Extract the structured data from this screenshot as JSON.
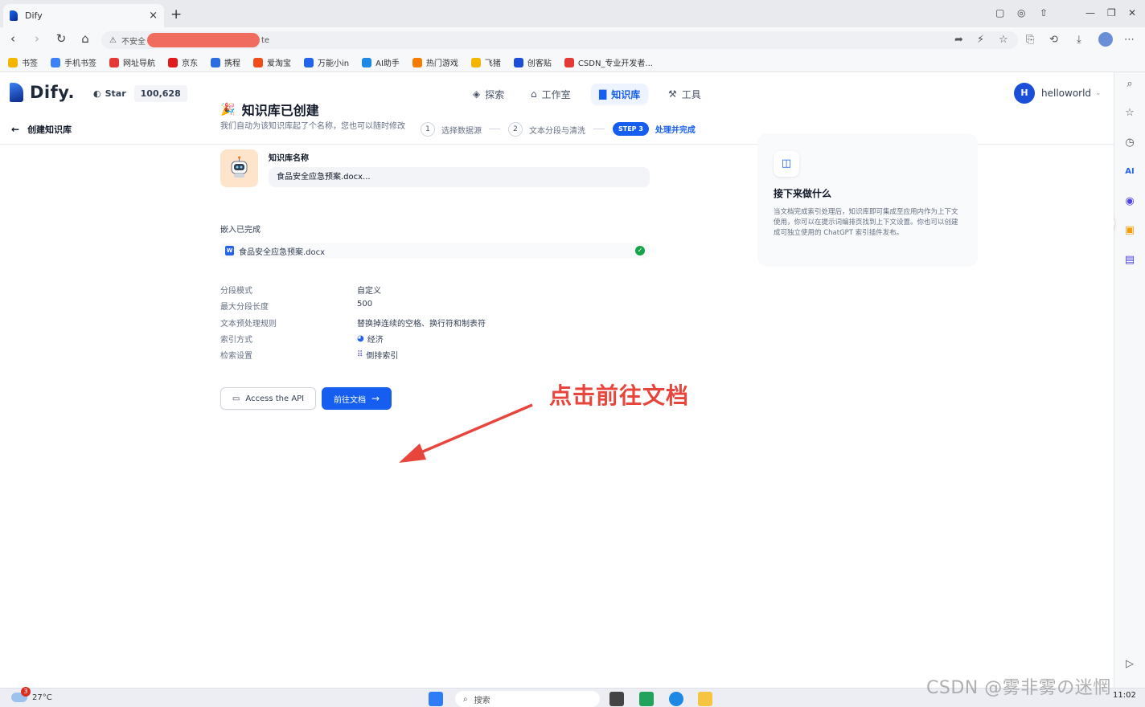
{
  "browser": {
    "tab_title": "Dify",
    "tab_close": "×",
    "new_tab": "+",
    "url_insecure_label": "不安全",
    "url_suffix": "te",
    "bookmarks": [
      {
        "label": "书签",
        "color": "#f5b400"
      },
      {
        "label": "手机书签",
        "color": "#3b82f6"
      },
      {
        "label": "网址导航",
        "color": "#e53935"
      },
      {
        "label": "京东",
        "color": "#e01b1b"
      },
      {
        "label": "携程",
        "color": "#2b6de0"
      },
      {
        "label": "爱淘宝",
        "color": "#f04b1a"
      },
      {
        "label": "万能小in",
        "color": "#2563eb"
      },
      {
        "label": "AI助手",
        "color": "#1e88e5"
      },
      {
        "label": "热门游戏",
        "color": "#f57c00"
      },
      {
        "label": "飞猪",
        "color": "#f5b400"
      },
      {
        "label": "创客贴",
        "color": "#1d4ed8"
      },
      {
        "label": "CSDN_专业开发者...",
        "color": "#e53935"
      }
    ]
  },
  "app": {
    "logo_text": "Dify.",
    "github_star_label": "Star",
    "github_star_count": "100,628",
    "nav_tabs": [
      {
        "label": "探索",
        "icon": "compass-icon"
      },
      {
        "label": "工作室",
        "icon": "robot-icon"
      },
      {
        "label": "知识库",
        "icon": "book-icon",
        "active": true
      },
      {
        "label": "工具",
        "icon": "tool-icon"
      }
    ],
    "user_initial": "H",
    "user_name": "helloworld"
  },
  "subnav": {
    "back_label": "创建知识库",
    "steps": [
      {
        "num": "1",
        "label": "选择数据源"
      },
      {
        "num": "2",
        "label": "文本分段与清洗"
      },
      {
        "num": "STEP 3",
        "label": "处理并完成",
        "active": true
      }
    ]
  },
  "content": {
    "title": "知识库已创建",
    "subtitle": "我们自动为该知识库起了个名称，您也可以随时修改",
    "kb_name_label": "知识库名称",
    "kb_name_value": "食品安全应急预案.docx...",
    "embed_label": "嵌入已完成",
    "file_name": "食品安全应急预案.docx",
    "properties": [
      {
        "key": "分段模式",
        "value": "自定义",
        "icon": ""
      },
      {
        "key": "最大分段长度",
        "value": "500",
        "icon": ""
      },
      {
        "key": "文本预处理规则",
        "value": "替换掉连续的空格、换行符和制表符",
        "icon": ""
      },
      {
        "key": "索引方式",
        "value": "经济",
        "icon": "piggy-bank-icon"
      },
      {
        "key": "检索设置",
        "value": "倒排索引",
        "icon": "grid-icon"
      }
    ],
    "api_button_label": "Access the API",
    "go_doc_button_label": "前往文档"
  },
  "next_card": {
    "title": "接下来做什么",
    "description": "当文档完成索引处理后，知识库即可集成至应用内作为上下文使用，你可以在提示词编排页找到上下文设置。你也可以创建成可独立使用的 ChatGPT 索引插件发布。"
  },
  "annotation": {
    "text": "点击前往文档",
    "color": "#e8453c"
  },
  "taskbar": {
    "weather_temp": "27°C",
    "weather_badge": "3",
    "search_placeholder": "搜索",
    "clock": "11:02",
    "watermark": "CSDN @雾非雾の迷惘"
  }
}
